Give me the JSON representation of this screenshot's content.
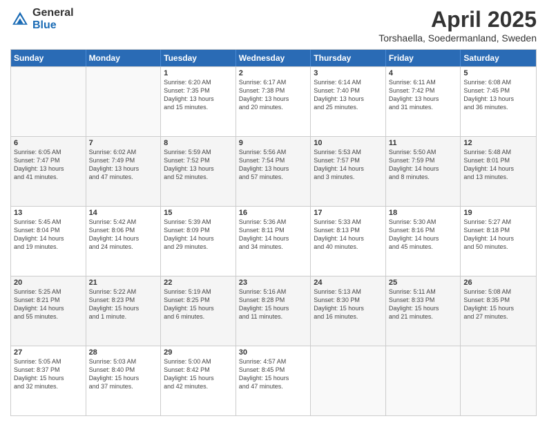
{
  "logo": {
    "general": "General",
    "blue": "Blue"
  },
  "title": "April 2025",
  "location": "Torshaella, Soedermanland, Sweden",
  "days_header": [
    "Sunday",
    "Monday",
    "Tuesday",
    "Wednesday",
    "Thursday",
    "Friday",
    "Saturday"
  ],
  "weeks": [
    [
      {
        "day": "",
        "info": ""
      },
      {
        "day": "",
        "info": ""
      },
      {
        "day": "1",
        "info": "Sunrise: 6:20 AM\nSunset: 7:35 PM\nDaylight: 13 hours\nand 15 minutes."
      },
      {
        "day": "2",
        "info": "Sunrise: 6:17 AM\nSunset: 7:38 PM\nDaylight: 13 hours\nand 20 minutes."
      },
      {
        "day": "3",
        "info": "Sunrise: 6:14 AM\nSunset: 7:40 PM\nDaylight: 13 hours\nand 25 minutes."
      },
      {
        "day": "4",
        "info": "Sunrise: 6:11 AM\nSunset: 7:42 PM\nDaylight: 13 hours\nand 31 minutes."
      },
      {
        "day": "5",
        "info": "Sunrise: 6:08 AM\nSunset: 7:45 PM\nDaylight: 13 hours\nand 36 minutes."
      }
    ],
    [
      {
        "day": "6",
        "info": "Sunrise: 6:05 AM\nSunset: 7:47 PM\nDaylight: 13 hours\nand 41 minutes."
      },
      {
        "day": "7",
        "info": "Sunrise: 6:02 AM\nSunset: 7:49 PM\nDaylight: 13 hours\nand 47 minutes."
      },
      {
        "day": "8",
        "info": "Sunrise: 5:59 AM\nSunset: 7:52 PM\nDaylight: 13 hours\nand 52 minutes."
      },
      {
        "day": "9",
        "info": "Sunrise: 5:56 AM\nSunset: 7:54 PM\nDaylight: 13 hours\nand 57 minutes."
      },
      {
        "day": "10",
        "info": "Sunrise: 5:53 AM\nSunset: 7:57 PM\nDaylight: 14 hours\nand 3 minutes."
      },
      {
        "day": "11",
        "info": "Sunrise: 5:50 AM\nSunset: 7:59 PM\nDaylight: 14 hours\nand 8 minutes."
      },
      {
        "day": "12",
        "info": "Sunrise: 5:48 AM\nSunset: 8:01 PM\nDaylight: 14 hours\nand 13 minutes."
      }
    ],
    [
      {
        "day": "13",
        "info": "Sunrise: 5:45 AM\nSunset: 8:04 PM\nDaylight: 14 hours\nand 19 minutes."
      },
      {
        "day": "14",
        "info": "Sunrise: 5:42 AM\nSunset: 8:06 PM\nDaylight: 14 hours\nand 24 minutes."
      },
      {
        "day": "15",
        "info": "Sunrise: 5:39 AM\nSunset: 8:09 PM\nDaylight: 14 hours\nand 29 minutes."
      },
      {
        "day": "16",
        "info": "Sunrise: 5:36 AM\nSunset: 8:11 PM\nDaylight: 14 hours\nand 34 minutes."
      },
      {
        "day": "17",
        "info": "Sunrise: 5:33 AM\nSunset: 8:13 PM\nDaylight: 14 hours\nand 40 minutes."
      },
      {
        "day": "18",
        "info": "Sunrise: 5:30 AM\nSunset: 8:16 PM\nDaylight: 14 hours\nand 45 minutes."
      },
      {
        "day": "19",
        "info": "Sunrise: 5:27 AM\nSunset: 8:18 PM\nDaylight: 14 hours\nand 50 minutes."
      }
    ],
    [
      {
        "day": "20",
        "info": "Sunrise: 5:25 AM\nSunset: 8:21 PM\nDaylight: 14 hours\nand 55 minutes."
      },
      {
        "day": "21",
        "info": "Sunrise: 5:22 AM\nSunset: 8:23 PM\nDaylight: 15 hours\nand 1 minute."
      },
      {
        "day": "22",
        "info": "Sunrise: 5:19 AM\nSunset: 8:25 PM\nDaylight: 15 hours\nand 6 minutes."
      },
      {
        "day": "23",
        "info": "Sunrise: 5:16 AM\nSunset: 8:28 PM\nDaylight: 15 hours\nand 11 minutes."
      },
      {
        "day": "24",
        "info": "Sunrise: 5:13 AM\nSunset: 8:30 PM\nDaylight: 15 hours\nand 16 minutes."
      },
      {
        "day": "25",
        "info": "Sunrise: 5:11 AM\nSunset: 8:33 PM\nDaylight: 15 hours\nand 21 minutes."
      },
      {
        "day": "26",
        "info": "Sunrise: 5:08 AM\nSunset: 8:35 PM\nDaylight: 15 hours\nand 27 minutes."
      }
    ],
    [
      {
        "day": "27",
        "info": "Sunrise: 5:05 AM\nSunset: 8:37 PM\nDaylight: 15 hours\nand 32 minutes."
      },
      {
        "day": "28",
        "info": "Sunrise: 5:03 AM\nSunset: 8:40 PM\nDaylight: 15 hours\nand 37 minutes."
      },
      {
        "day": "29",
        "info": "Sunrise: 5:00 AM\nSunset: 8:42 PM\nDaylight: 15 hours\nand 42 minutes."
      },
      {
        "day": "30",
        "info": "Sunrise: 4:57 AM\nSunset: 8:45 PM\nDaylight: 15 hours\nand 47 minutes."
      },
      {
        "day": "",
        "info": ""
      },
      {
        "day": "",
        "info": ""
      },
      {
        "day": "",
        "info": ""
      }
    ]
  ]
}
